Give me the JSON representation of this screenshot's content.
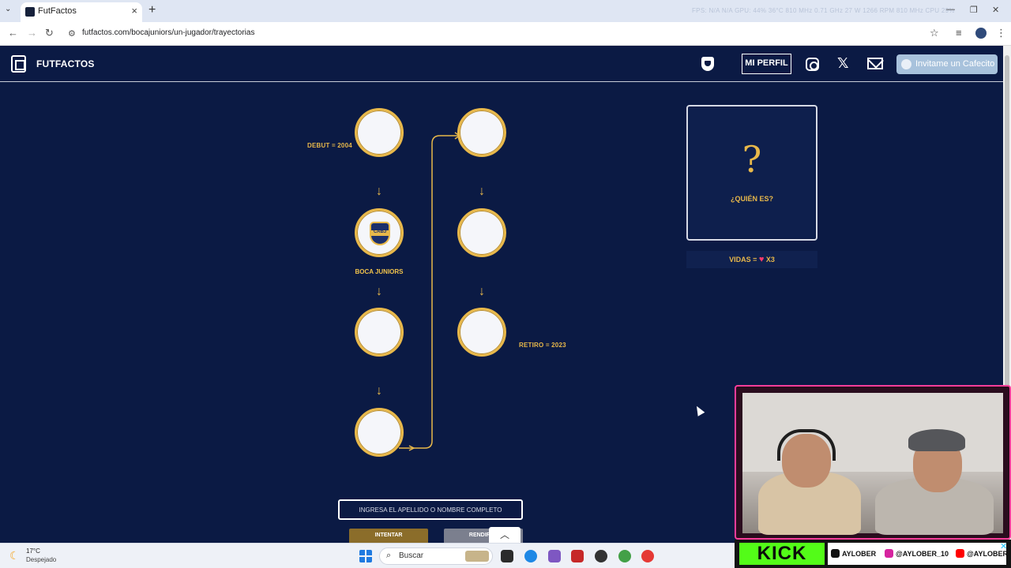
{
  "browser": {
    "tab_title": "FutFactos",
    "url": "futfactos.com/bocajuniors/un-jugador/trayectorias",
    "sysinfo": "FPS: N/A  N/A    GPU: 44% 36°C  810 MHz  0.71 GHz 27 W  1266 RPM  810 MHz    CPU 29%"
  },
  "header": {
    "brand": "FUTFACTOS",
    "profile_label": "MI PERFIL",
    "cafecito_label": "Invitame un Cafecito"
  },
  "career": {
    "debut_label": "DEBUT = 2004",
    "retiro_label": "RETIRO = 2023",
    "known_team": "BOCA JUNIORS",
    "badge_text": "CABJ"
  },
  "mystery": {
    "symbol": "?",
    "prompt": "¿QUIÉN ES?",
    "lives_prefix": "VIDAS =",
    "lives_count": "X3"
  },
  "guess": {
    "placeholder": "INGRESA EL APELLIDO O NOMBRE COMPLETO",
    "try_label": "INTENTAR",
    "giveup_label": "RENDIRSE"
  },
  "taskbar": {
    "temperature": "17°C",
    "condition": "Despejado",
    "search_label": "Buscar"
  },
  "stream": {
    "platform": "KICK",
    "tiktok": "AYLOBER",
    "instagram": "@AYLOBER_10",
    "youtube": "@AYLOBER"
  },
  "colors": {
    "page_bg": "#0b1a44",
    "gold": "#e8b84a",
    "kick_green": "#53fc18",
    "cam_border": "#ff3d9a"
  }
}
